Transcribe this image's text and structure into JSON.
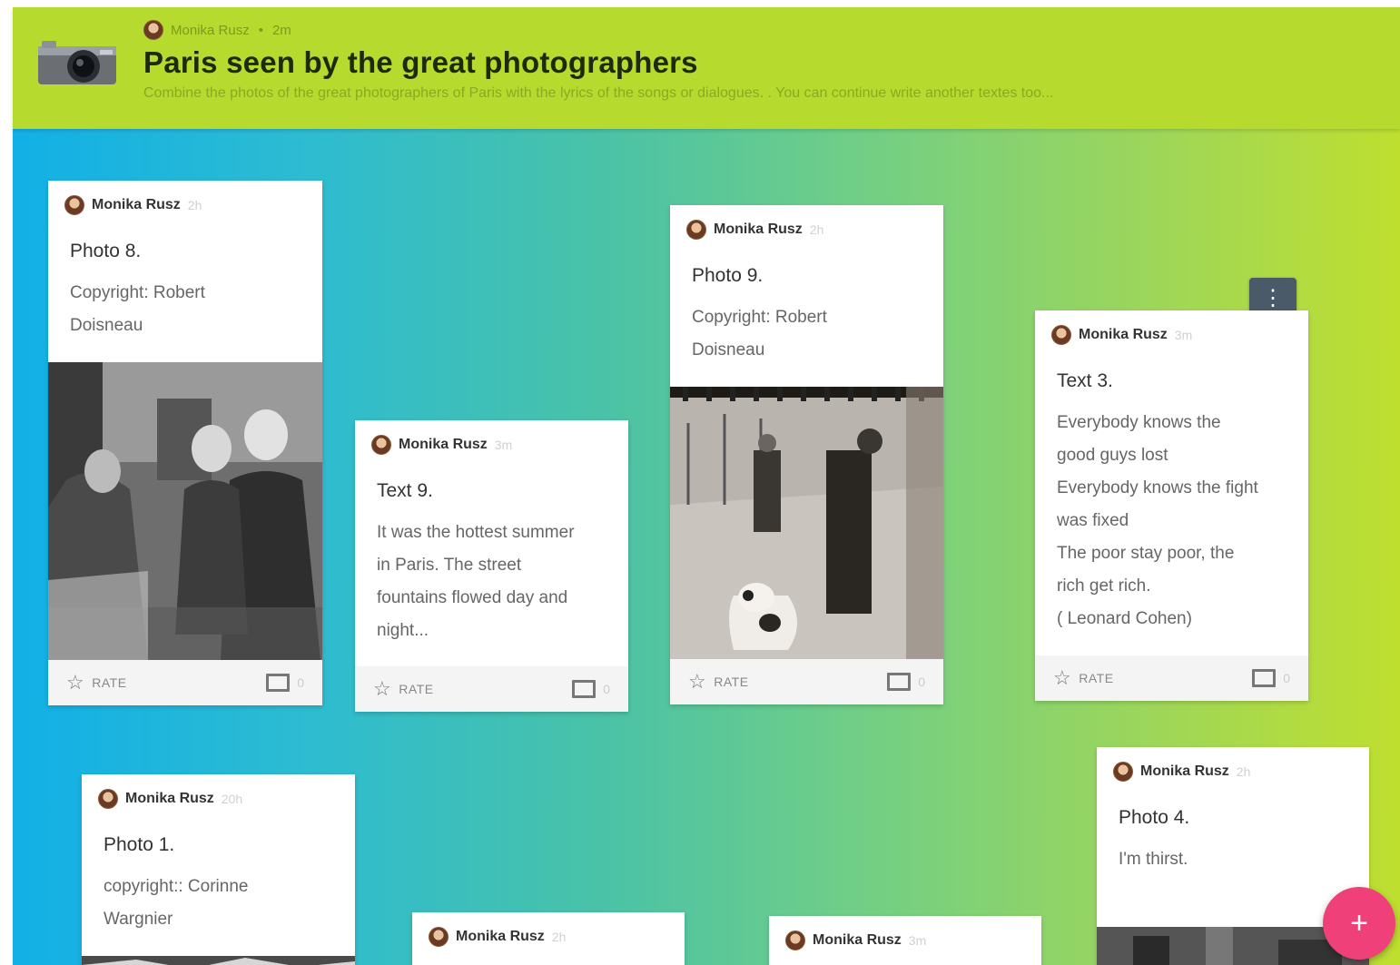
{
  "header": {
    "author": "Monika Rusz",
    "time": "2m",
    "title": "Paris seen by the great photographers",
    "description": "Combine the photos of the great photographers of Paris with the lyrics of the songs or dialogues. . You can continue write another textes too..."
  },
  "cards": {
    "photo8": {
      "author": "Monika Rusz",
      "time": "2h",
      "title": "Photo 8.",
      "body1": "Copyright: Robert",
      "body2": "Doisneau",
      "rate": "RATE",
      "comments": "0"
    },
    "text9": {
      "author": "Monika Rusz",
      "time": "3m",
      "title": "Text 9.",
      "body1": "It was the hottest summer",
      "body2": "in Paris. The street",
      "body3": "fountains  flowed day and",
      "body4": "night...",
      "rate": "RATE",
      "comments": "0"
    },
    "photo9": {
      "author": "Monika Rusz",
      "time": "2h",
      "title": "Photo 9.",
      "body1": "Copyright: Robert",
      "body2": "Doisneau",
      "rate": "RATE",
      "comments": "0"
    },
    "text3": {
      "author": "Monika Rusz",
      "time": "3m",
      "title": "Text 3.",
      "body1": "Everybody knows  the",
      "body2": "good guys lost",
      "body3": "Everybody knows the fight",
      "body4": "was fixed",
      "body5": "The poor stay poor, the",
      "body6": "rich get rich.",
      "body7": "( Leonard Cohen)",
      "rate": "RATE",
      "comments": "0"
    },
    "photo1": {
      "author": "Monika Rusz",
      "time": "20h",
      "title": "Photo 1.",
      "body1": "copyright:: Corinne",
      "body2": "Wargnier"
    },
    "photo4": {
      "author": "Monika Rusz",
      "time": "2h",
      "title": "Photo 4.",
      "body1": "I'm thirst."
    },
    "bottom1": {
      "author": "Monika Rusz",
      "time": "2h"
    },
    "bottom2": {
      "author": "Monika Rusz",
      "time": "3m"
    }
  },
  "menu_button": "⋮",
  "fab": "+",
  "icons": {
    "camera": "camera-icon",
    "star": "star-icon",
    "comment": "comment-icon"
  },
  "colors": {
    "header": "#b6da2e",
    "fab": "#f0407a",
    "gradient_left": "#12b0e7",
    "gradient_right": "#bfdf2f"
  }
}
